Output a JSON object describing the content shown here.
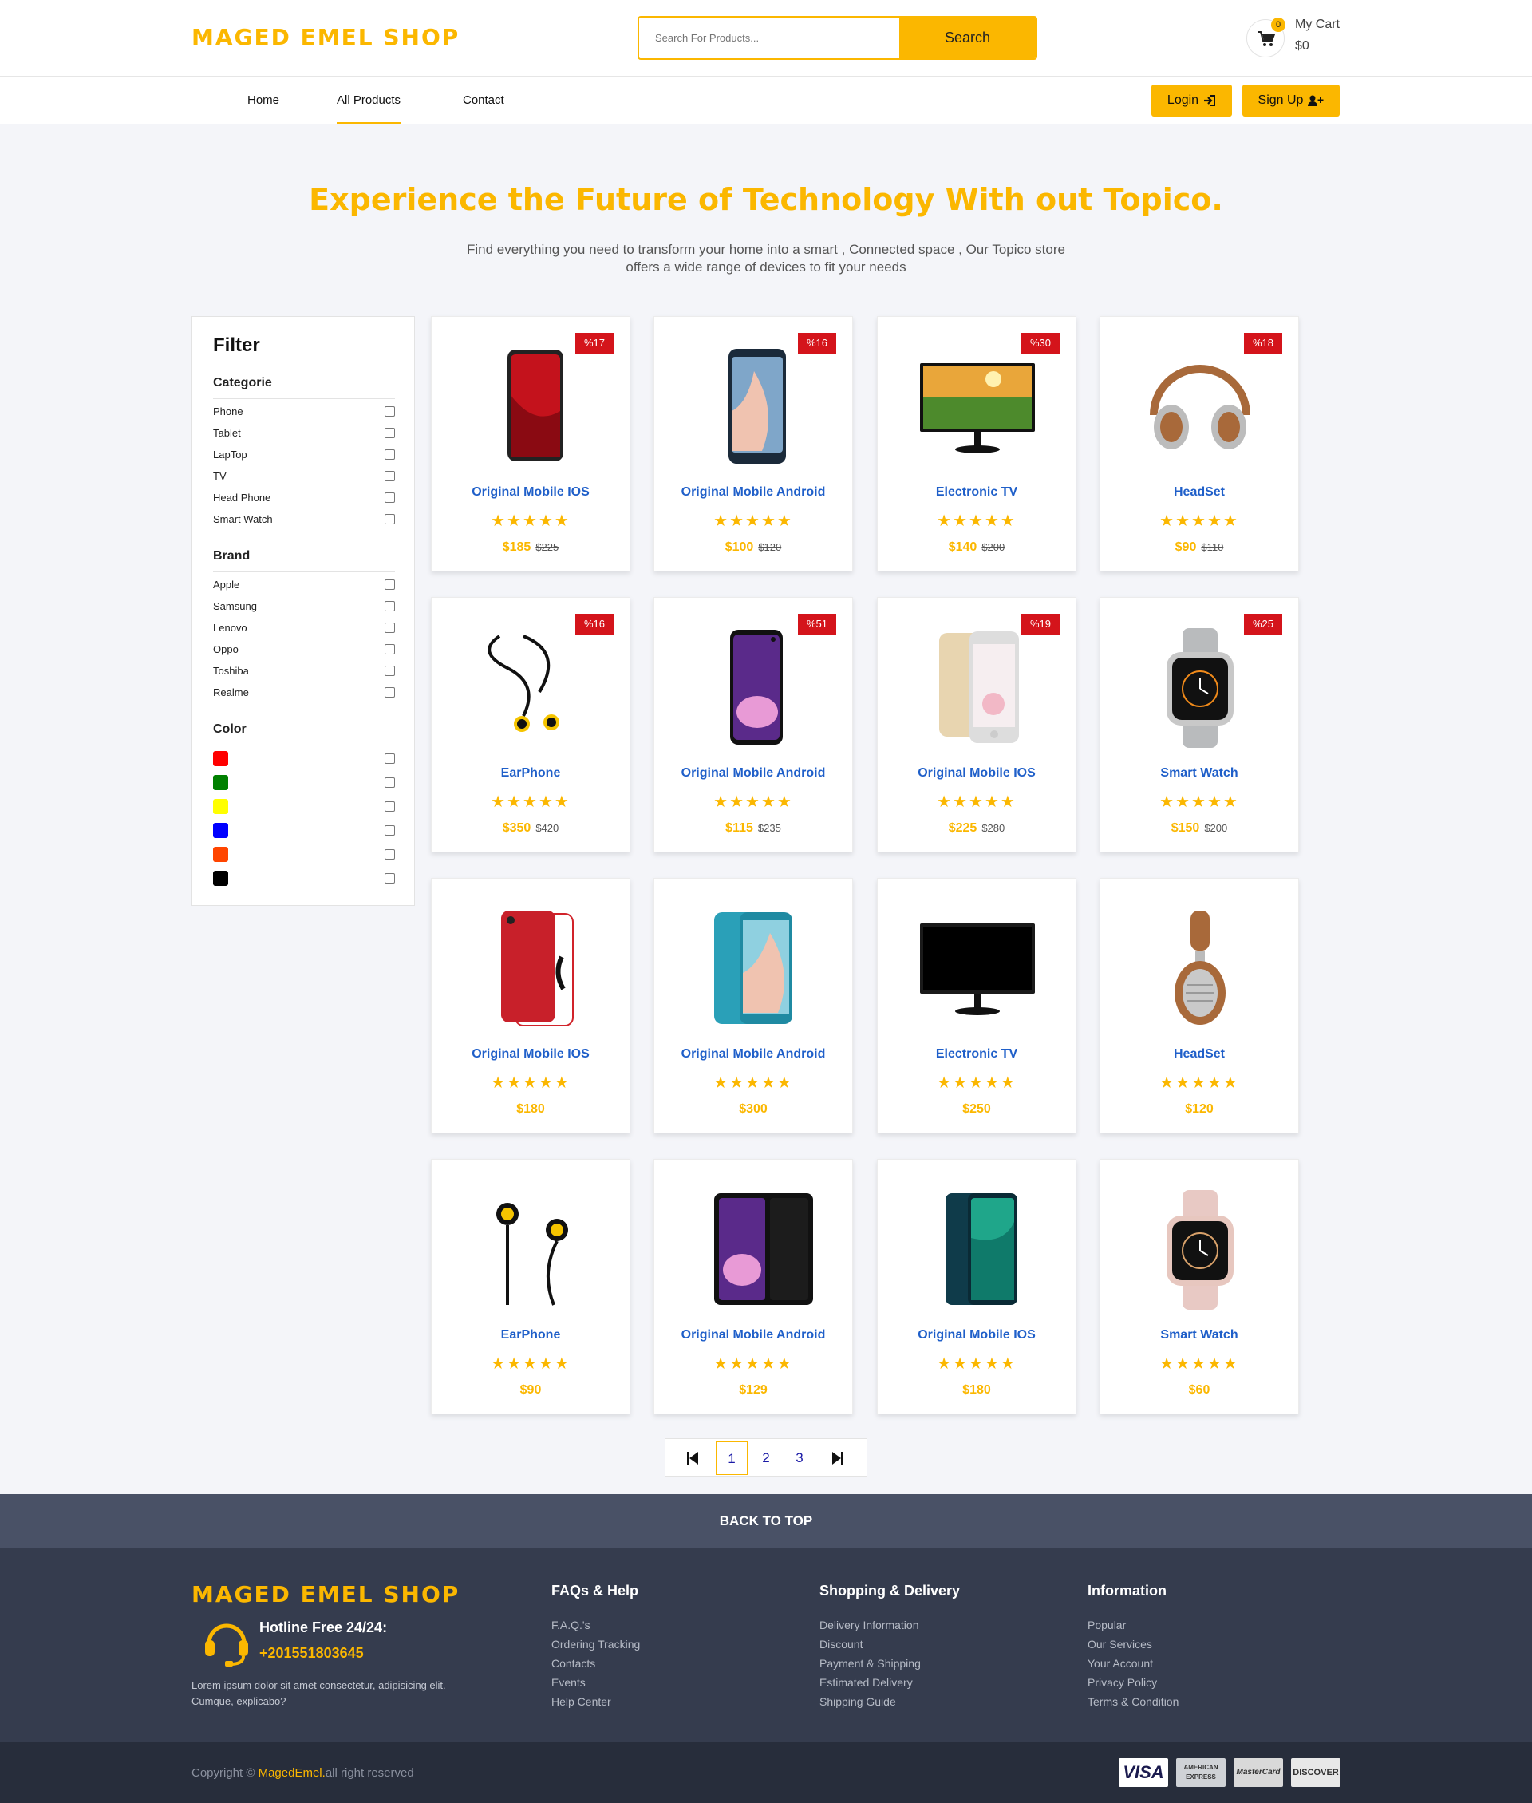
{
  "header": {
    "logo": "MAGED EMEL SHOP",
    "search_placeholder": "Search For Products...",
    "search_button": "Search",
    "cart_count": "0",
    "cart_label": "My Cart",
    "cart_total": "$0"
  },
  "nav": {
    "links": [
      "Home",
      "All Products",
      "Contact"
    ],
    "active": "All Products",
    "login": "Login",
    "signup": "Sign Up"
  },
  "hero": {
    "title": "Experience the Future of Technology With out Topico.",
    "subtitle_line1": "Find everything you need to transform your home into a smart , Connected space , Our Topico store",
    "subtitle_line2": "offers a wide range of devices to fit your needs"
  },
  "filter": {
    "title": "Filter",
    "categorie_heading": "Categorie",
    "categories": [
      "Phone",
      "Tablet",
      "LapTop",
      "TV",
      "Head Phone",
      "Smart Watch"
    ],
    "brand_heading": "Brand",
    "brands": [
      "Apple",
      "Samsung",
      "Lenovo",
      "Oppo",
      "Toshiba",
      "Realme"
    ],
    "color_heading": "Color",
    "colors": [
      "#ff0000",
      "#008000",
      "#ffff00",
      "#0000ff",
      "#ff4500",
      "#000000"
    ]
  },
  "products": [
    {
      "name": "Original Mobile IOS",
      "price": "$185",
      "old": "$225",
      "badge": "%17",
      "icon": "red-iphone"
    },
    {
      "name": "Original Mobile Android",
      "price": "$100",
      "old": "$120",
      "badge": "%16",
      "icon": "samsung-phone"
    },
    {
      "name": "Electronic TV",
      "price": "$140",
      "old": "$200",
      "badge": "%30",
      "icon": "monitor-landscape"
    },
    {
      "name": "HeadSet",
      "price": "$90",
      "old": "$110",
      "badge": "%18",
      "icon": "brown-headphones"
    },
    {
      "name": "EarPhone",
      "price": "$350",
      "old": "$420",
      "badge": "%16",
      "icon": "earphones"
    },
    {
      "name": "Original Mobile Android",
      "price": "$115",
      "old": "$235",
      "badge": "%51",
      "icon": "galaxy-s10"
    },
    {
      "name": "Original Mobile IOS",
      "price": "$225",
      "old": "$280",
      "badge": "%19",
      "icon": "gold-iphone"
    },
    {
      "name": "Smart Watch",
      "price": "$150",
      "old": "$200",
      "badge": "%25",
      "icon": "apple-watch-silver"
    },
    {
      "name": "Original Mobile IOS",
      "price": "$180",
      "old": "",
      "badge": "",
      "icon": "red-iphone-back"
    },
    {
      "name": "Original Mobile Android",
      "price": "$300",
      "old": "",
      "badge": "",
      "icon": "blue-samsung"
    },
    {
      "name": "Electronic TV",
      "price": "$250",
      "old": "",
      "badge": "",
      "icon": "black-monitor"
    },
    {
      "name": "HeadSet",
      "price": "$120",
      "old": "",
      "badge": "",
      "icon": "headphone-side"
    },
    {
      "name": "EarPhone",
      "price": "$90",
      "old": "",
      "badge": "",
      "icon": "earphones-yellow"
    },
    {
      "name": "Original Mobile Android",
      "price": "$129",
      "old": "",
      "badge": "",
      "icon": "galaxy-front-back"
    },
    {
      "name": "Original Mobile IOS",
      "price": "$180",
      "old": "",
      "badge": "",
      "icon": "oppo-phone"
    },
    {
      "name": "Smart Watch",
      "price": "$60",
      "old": "",
      "badge": "",
      "icon": "pink-watch"
    }
  ],
  "pagination": {
    "pages": [
      "1",
      "2",
      "3"
    ],
    "current": "1"
  },
  "back_to_top": "BACK TO TOP",
  "footer": {
    "logo": "MAGED EMEL SHOP",
    "hotline_label": "Hotline Free 24/24:",
    "hotline_number": "+201551803645",
    "about_line1": "Lorem ipsum dolor sit amet consectetur, adipisicing elit.",
    "about_line2": "Cumque, explicabo?",
    "columns": [
      {
        "title": "FAQs & Help",
        "links": [
          "F.A.Q.'s",
          "Ordering Tracking",
          "Contacts",
          "Events",
          "Help Center"
        ]
      },
      {
        "title": "Shopping & Delivery",
        "links": [
          "Delivery Information",
          "Discount",
          "Payment & Shipping",
          "Estimated Delivery",
          "Shipping Guide"
        ]
      },
      {
        "title": "Information",
        "links": [
          "Popular",
          "Our Services",
          "Your Account",
          "Privacy Policy",
          "Terms & Condition"
        ]
      }
    ],
    "copyright_prefix": "Copyright ©",
    "copyright_brand": "MagedEmel.",
    "copyright_suffix": "all right reserved",
    "payments": [
      "VISA",
      "AMERICAN EXPRESS",
      "MasterCard",
      "DISCOVER"
    ]
  },
  "colors": {
    "accent": "#fbb700",
    "link": "#1f5fc9",
    "badge": "#d4141b",
    "footer": "#353c4e"
  }
}
